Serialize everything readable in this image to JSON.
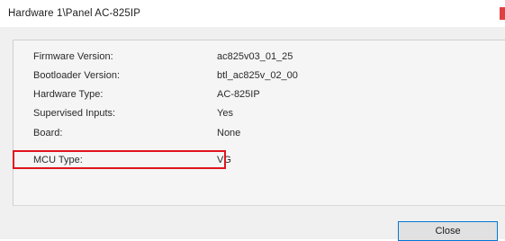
{
  "window": {
    "title": "Hardware 1\\Panel AC-825IP"
  },
  "info": {
    "rows": [
      {
        "label": "Firmware Version:",
        "value": "ac825v03_01_25"
      },
      {
        "label": "Bootloader Version:",
        "value": "btl_ac825v_02_00"
      },
      {
        "label": "Hardware Type:",
        "value": "AC-825IP"
      },
      {
        "label": "Supervised Inputs:",
        "value": "Yes"
      },
      {
        "label": "Board:",
        "value": "None"
      },
      {
        "label": "MCU Type:",
        "value": "VG"
      }
    ]
  },
  "buttons": {
    "close_label": "Close"
  },
  "colors": {
    "highlight": "#e0141e",
    "button_border": "#0078d7",
    "title_close_accent": "#e04040"
  }
}
